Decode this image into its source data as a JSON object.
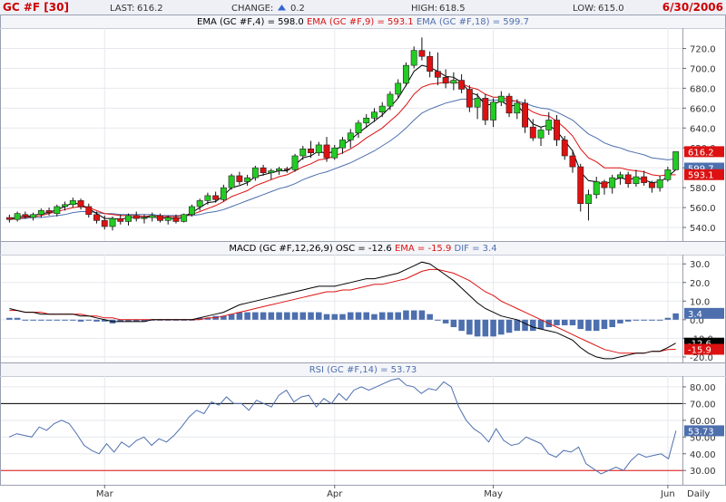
{
  "header": {
    "symbol": "GC #F [30]",
    "last_label": "LAST:",
    "last_value": "616.2",
    "change_label": "CHANGE:",
    "change_value": "0.2",
    "high_label": "HIGH:",
    "high_value": "618.5",
    "low_label": "LOW:",
    "low_value": "615.0",
    "date": "6/30/2006"
  },
  "colors": {
    "up_candle": "#22cc22",
    "down_candle": "#dd1111",
    "ema4": "#000000",
    "ema9": "#dd1111",
    "ema18": "#4d6fae",
    "macd_hist": "#4d6fae",
    "rsi_line": "#4d6fae",
    "rsi_upper": "#000000",
    "rsi_lower": "#dd1111",
    "header_red": "#cc0000",
    "header_bg": "#eef0f6"
  },
  "chart_data": [
    {
      "type": "candlestick",
      "legend": [
        {
          "text": "EMA (GC #F,4) = 598.0",
          "color": "#000000"
        },
        {
          "text": "EMA (GC #F,9) = 593.1",
          "color": "#dd1111"
        },
        {
          "text": "EMA (GC #F,18) = 599.7",
          "color": "#4d6fae"
        }
      ],
      "ylim": [
        530,
        735
      ],
      "ticks": [
        "720.0",
        "700.0",
        "680.0",
        "660.0",
        "640.0",
        "620.0",
        "600.0",
        "580.0",
        "560.0",
        "540.0"
      ],
      "tags": [
        {
          "label": "616.2",
          "value": 616.2,
          "color": "#dd1111"
        },
        {
          "label": "599.7",
          "value": 599.7,
          "color": "#4d6fae"
        },
        {
          "label": "593.1",
          "value": 593.1,
          "color": "#dd1111"
        }
      ],
      "x_axis": {
        "labels": [
          "Mar",
          "Apr",
          "May",
          "Jun"
        ],
        "label_index": [
          12,
          41,
          61,
          83
        ],
        "period": "Daily"
      },
      "ohlc": [
        [
          550,
          553,
          545,
          548
        ],
        [
          548,
          556,
          546,
          554
        ],
        [
          553,
          556,
          549,
          551
        ],
        [
          550,
          555,
          547,
          553
        ],
        [
          553,
          559,
          550,
          557
        ],
        [
          557,
          560,
          552,
          555
        ],
        [
          554,
          563,
          551,
          561
        ],
        [
          561,
          566,
          557,
          563
        ],
        [
          563,
          570,
          560,
          567
        ],
        [
          567,
          569,
          558,
          561
        ],
        [
          561,
          564,
          550,
          553
        ],
        [
          553,
          556,
          544,
          547
        ],
        [
          547,
          552,
          538,
          541
        ],
        [
          541,
          551,
          537,
          549
        ],
        [
          549,
          553,
          543,
          546
        ],
        [
          546,
          554,
          542,
          552
        ],
        [
          552,
          556,
          546,
          549
        ],
        [
          549,
          553,
          544,
          550
        ],
        [
          550,
          555,
          546,
          552
        ],
        [
          552,
          554,
          545,
          547
        ],
        [
          547,
          552,
          543,
          550
        ],
        [
          550,
          553,
          544,
          546
        ],
        [
          546,
          554,
          545,
          553
        ],
        [
          553,
          563,
          551,
          561
        ],
        [
          561,
          569,
          557,
          567
        ],
        [
          567,
          575,
          563,
          572
        ],
        [
          572,
          576,
          565,
          568
        ],
        [
          568,
          583,
          566,
          580
        ],
        [
          580,
          594,
          578,
          592
        ],
        [
          592,
          596,
          583,
          586
        ],
        [
          586,
          593,
          582,
          590
        ],
        [
          590,
          602,
          587,
          600
        ],
        [
          600,
          603,
          592,
          595
        ],
        [
          595,
          599,
          588,
          597
        ],
        [
          597,
          601,
          593,
          599
        ],
        [
          599,
          601,
          595,
          598
        ],
        [
          598,
          614,
          596,
          612
        ],
        [
          612,
          622,
          608,
          619
        ],
        [
          619,
          627,
          610,
          615
        ],
        [
          615,
          626,
          612,
          623
        ],
        [
          623,
          631,
          606,
          610
        ],
        [
          610,
          623,
          608,
          620
        ],
        [
          620,
          631,
          614,
          628
        ],
        [
          628,
          639,
          620,
          635
        ],
        [
          635,
          648,
          630,
          645
        ],
        [
          645,
          654,
          640,
          650
        ],
        [
          650,
          660,
          646,
          656
        ],
        [
          656,
          666,
          651,
          662
        ],
        [
          662,
          677,
          658,
          674
        ],
        [
          674,
          689,
          670,
          685
        ],
        [
          685,
          706,
          682,
          703
        ],
        [
          703,
          722,
          700,
          718
        ],
        [
          718,
          731,
          708,
          712
        ],
        [
          712,
          717,
          691,
          697
        ],
        [
          697,
          716,
          683,
          691
        ],
        [
          691,
          699,
          680,
          685
        ],
        [
          685,
          696,
          678,
          688
        ],
        [
          688,
          694,
          675,
          679
        ],
        [
          679,
          683,
          656,
          661
        ],
        [
          661,
          675,
          649,
          670
        ],
        [
          670,
          674,
          643,
          648
        ],
        [
          648,
          670,
          641,
          666
        ],
        [
          666,
          677,
          662,
          672
        ],
        [
          672,
          675,
          651,
          655
        ],
        [
          655,
          669,
          649,
          665
        ],
        [
          665,
          669,
          635,
          641
        ],
        [
          641,
          649,
          627,
          630
        ],
        [
          630,
          641,
          622,
          638
        ],
        [
          638,
          656,
          633,
          648
        ],
        [
          648,
          653,
          622,
          628
        ],
        [
          628,
          632,
          608,
          612
        ],
        [
          612,
          618,
          595,
          601
        ],
        [
          601,
          604,
          556,
          564
        ],
        [
          564,
          578,
          547,
          573
        ],
        [
          573,
          591,
          569,
          586
        ],
        [
          586,
          588,
          573,
          580
        ],
        [
          580,
          593,
          574,
          590
        ],
        [
          590,
          596,
          583,
          593
        ],
        [
          593,
          596,
          580,
          584
        ],
        [
          584,
          598,
          581,
          591
        ],
        [
          591,
          597,
          582,
          585
        ],
        [
          585,
          587,
          575,
          580
        ],
        [
          580,
          592,
          576,
          588
        ],
        [
          588,
          601,
          586,
          598
        ],
        [
          598,
          599,
          611,
          616.2
        ]
      ],
      "ema4": [
        548,
        551,
        551,
        552,
        554,
        555,
        558,
        561,
        565,
        563,
        559,
        554,
        549,
        549,
        548,
        550,
        550,
        550,
        551,
        549,
        550,
        548,
        551,
        555,
        560,
        565,
        566,
        572,
        580,
        582,
        585,
        591,
        593,
        595,
        597,
        597,
        603,
        610,
        612,
        617,
        614,
        617,
        623,
        628,
        635,
        641,
        647,
        653,
        661,
        670,
        683,
        697,
        703,
        701,
        697,
        692,
        691,
        686,
        676,
        673,
        663,
        664,
        667,
        662,
        663,
        654,
        644,
        641,
        643,
        637,
        627,
        617,
        596,
        587,
        586,
        583,
        587,
        590,
        588,
        590,
        588,
        585,
        586,
        591,
        598
      ],
      "ema9": [
        548,
        549,
        550,
        551,
        552,
        554,
        556,
        558,
        560,
        561,
        560,
        557,
        554,
        553,
        552,
        552,
        552,
        551,
        552,
        551,
        551,
        551,
        552,
        553,
        556,
        559,
        562,
        566,
        571,
        574,
        577,
        582,
        585,
        588,
        591,
        593,
        597,
        601,
        604,
        608,
        609,
        612,
        615,
        619,
        624,
        630,
        635,
        640,
        647,
        654,
        663,
        674,
        681,
        684,
        685,
        686,
        686,
        685,
        681,
        679,
        674,
        671,
        671,
        668,
        667,
        661,
        656,
        653,
        652,
        647,
        640,
        632,
        619,
        610,
        606,
        600,
        600,
        600,
        598,
        597,
        596,
        593,
        592,
        593,
        593
      ],
      "ema18": [
        548,
        549,
        549,
        550,
        550,
        551,
        552,
        553,
        555,
        556,
        556,
        555,
        554,
        554,
        553,
        553,
        553,
        553,
        553,
        552,
        552,
        552,
        552,
        552,
        553,
        555,
        556,
        558,
        561,
        564,
        567,
        570,
        573,
        576,
        579,
        581,
        584,
        588,
        591,
        594,
        596,
        599,
        602,
        605,
        609,
        613,
        617,
        622,
        627,
        633,
        640,
        648,
        655,
        659,
        662,
        665,
        667,
        669,
        669,
        669,
        668,
        668,
        668,
        667,
        667,
        665,
        662,
        660,
        659,
        656,
        652,
        648,
        641,
        634,
        630,
        625,
        622,
        620,
        617,
        615,
        613,
        610,
        609,
        608,
        609
      ]
    },
    {
      "type": "macd",
      "legend": [
        {
          "text": "MACD (GC #F,12,26,9) OSC = -12.6",
          "color": "#000000"
        },
        {
          "text": "EMA = -15.9",
          "color": "#dd1111"
        },
        {
          "text": "DIF = 3.4",
          "color": "#4d6fae"
        }
      ],
      "ylim": [
        -22,
        34
      ],
      "ticks": [
        "30.0",
        "20.0",
        "10.0",
        "0.0",
        "-10.0",
        "-20.0"
      ],
      "tags": [
        {
          "label": "3.4",
          "value": 3.4,
          "color": "#4d6fae"
        },
        {
          "label": "-12.6",
          "value": -12.6,
          "color": "#000000"
        },
        {
          "label": "-15.9",
          "value": -15.9,
          "color": "#dd1111"
        }
      ],
      "macd": [
        6,
        5,
        4,
        4,
        3,
        3,
        3,
        3,
        3,
        2,
        2,
        1,
        0,
        -1,
        -1,
        -1,
        -1,
        -1,
        0,
        0,
        0,
        0,
        0,
        0,
        1,
        2,
        3,
        4,
        6,
        8,
        9,
        10,
        11,
        12,
        13,
        14,
        15,
        16,
        17,
        18,
        18,
        18,
        19,
        20,
        21,
        22,
        22,
        23,
        24,
        25,
        27,
        29,
        31,
        30,
        27,
        24,
        21,
        17,
        13,
        9,
        6,
        4,
        2,
        1,
        0,
        -2,
        -4,
        -5,
        -6,
        -7,
        -9,
        -11,
        -15,
        -18,
        -20,
        -21,
        -21,
        -20,
        -19,
        -18,
        -18,
        -17,
        -17,
        -15,
        -12.6
      ],
      "signal": [
        5,
        5,
        4,
        4,
        4,
        3,
        3,
        3,
        3,
        3,
        2,
        2,
        1,
        1,
        0,
        0,
        0,
        0,
        0,
        0,
        0,
        0,
        0,
        0,
        0,
        1,
        1,
        2,
        3,
        4,
        5,
        6,
        7,
        8,
        9,
        10,
        11,
        12,
        13,
        14,
        15,
        15,
        16,
        16,
        17,
        18,
        19,
        19,
        20,
        21,
        22,
        24,
        26,
        27,
        27,
        26,
        25,
        23,
        21,
        18,
        15,
        13,
        10,
        8,
        6,
        4,
        2,
        0,
        -2,
        -4,
        -6,
        -8,
        -10,
        -12,
        -14,
        -16,
        -17,
        -18,
        -18,
        -18,
        -18,
        -17,
        -17,
        -16,
        -15.9
      ],
      "histogram": [
        1,
        1,
        0,
        0,
        0,
        0,
        0,
        0,
        0,
        -1,
        0,
        -1,
        -1,
        -2,
        -1,
        -1,
        -1,
        -1,
        0,
        0,
        0,
        0,
        0,
        0,
        1,
        1,
        2,
        2,
        3,
        4,
        4,
        4,
        4,
        4,
        4,
        4,
        4,
        4,
        4,
        4,
        3,
        3,
        3,
        4,
        4,
        4,
        3,
        4,
        4,
        4,
        5,
        5,
        5,
        3,
        0,
        -2,
        -4,
        -6,
        -8,
        -9,
        -9,
        -9,
        -8,
        -7,
        -6,
        -6,
        -6,
        -5,
        -4,
        -3,
        -3,
        -3,
        -5,
        -6,
        -6,
        -5,
        -4,
        -2,
        -1,
        0,
        0,
        0,
        0,
        1,
        3.4
      ]
    },
    {
      "type": "line",
      "legend": [
        {
          "text": "RSI (GC #F,14) = 53.73",
          "color": "#4d6fae"
        }
      ],
      "ylim": [
        22,
        87
      ],
      "ticks": [
        "80.00",
        "70.00",
        "60.00",
        "50.00",
        "40.00",
        "30.00"
      ],
      "tags": [
        {
          "label": "53.73",
          "value": 53.73,
          "color": "#4d6fae"
        }
      ],
      "reference_lines": [
        70,
        30
      ],
      "rsi": [
        50,
        52,
        51,
        50,
        56,
        54,
        58,
        60,
        58,
        52,
        45,
        42,
        40,
        46,
        41,
        47,
        44,
        48,
        50,
        45,
        49,
        47,
        51,
        56,
        62,
        66,
        64,
        71,
        69,
        74,
        70,
        70,
        66,
        72,
        70,
        68,
        75,
        78,
        71,
        74,
        75,
        68,
        73,
        70,
        76,
        72,
        78,
        80,
        78,
        80,
        82,
        84,
        85,
        81,
        80,
        76,
        79,
        78,
        83,
        80,
        68,
        60,
        55,
        52,
        47,
        55,
        48,
        45,
        46,
        50,
        48,
        46,
        40,
        38,
        42,
        41,
        44,
        34,
        31,
        28,
        30,
        32,
        30,
        36,
        40,
        38,
        39,
        40,
        37,
        53.73
      ]
    }
  ]
}
